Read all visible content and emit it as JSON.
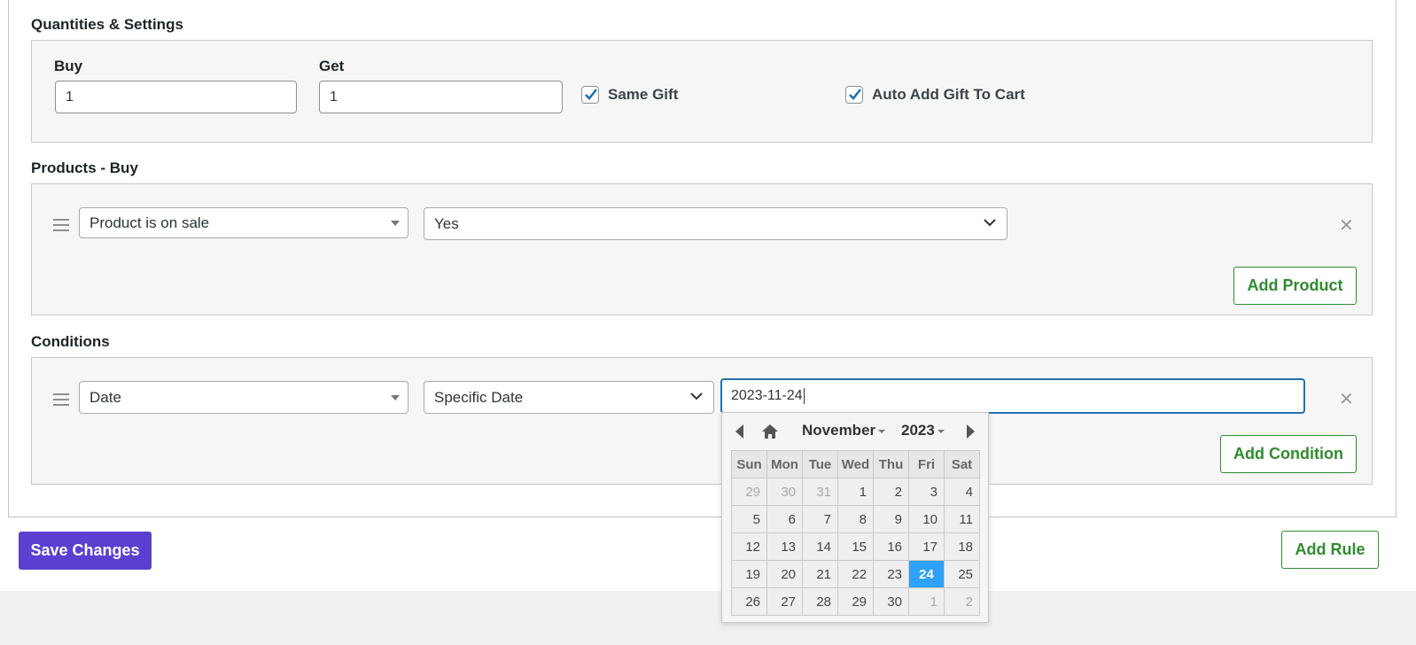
{
  "sections": {
    "quantities_title": "Quantities & Settings",
    "products_title": "Products - Buy",
    "conditions_title": "Conditions"
  },
  "quantities": {
    "buy_label": "Buy",
    "buy_value": "1",
    "get_label": "Get",
    "get_value": "1",
    "same_gift_label": "Same Gift",
    "same_gift_checked": true,
    "auto_add_label": "Auto Add Gift To Cart",
    "auto_add_checked": true
  },
  "products": {
    "rule_type": "Product is on sale",
    "rule_value": "Yes",
    "add_button": "Add Product"
  },
  "conditions": {
    "type": "Date",
    "operator": "Specific Date",
    "date_value": "2023-11-24",
    "add_button": "Add Condition"
  },
  "datepicker": {
    "month": "November",
    "year": "2023",
    "weekdays": [
      "Sun",
      "Mon",
      "Tue",
      "Wed",
      "Thu",
      "Fri",
      "Sat"
    ],
    "weeks": [
      [
        "29",
        "30",
        "31",
        "1",
        "2",
        "3",
        "4"
      ],
      [
        "5",
        "6",
        "7",
        "8",
        "9",
        "10",
        "11"
      ],
      [
        "12",
        "13",
        "14",
        "15",
        "16",
        "17",
        "18"
      ],
      [
        "19",
        "20",
        "21",
        "22",
        "23",
        "24",
        "25"
      ],
      [
        "26",
        "27",
        "28",
        "29",
        "30",
        "1",
        "2"
      ]
    ],
    "selected_day": "24"
  },
  "footer": {
    "save_button": "Save Changes",
    "add_rule_button": "Add Rule"
  },
  "colors": {
    "primary": "#5b3fd1",
    "accent_green": "#2f8b2f",
    "focus_blue": "#2271b1",
    "selected_day": "#2ea2f8"
  }
}
